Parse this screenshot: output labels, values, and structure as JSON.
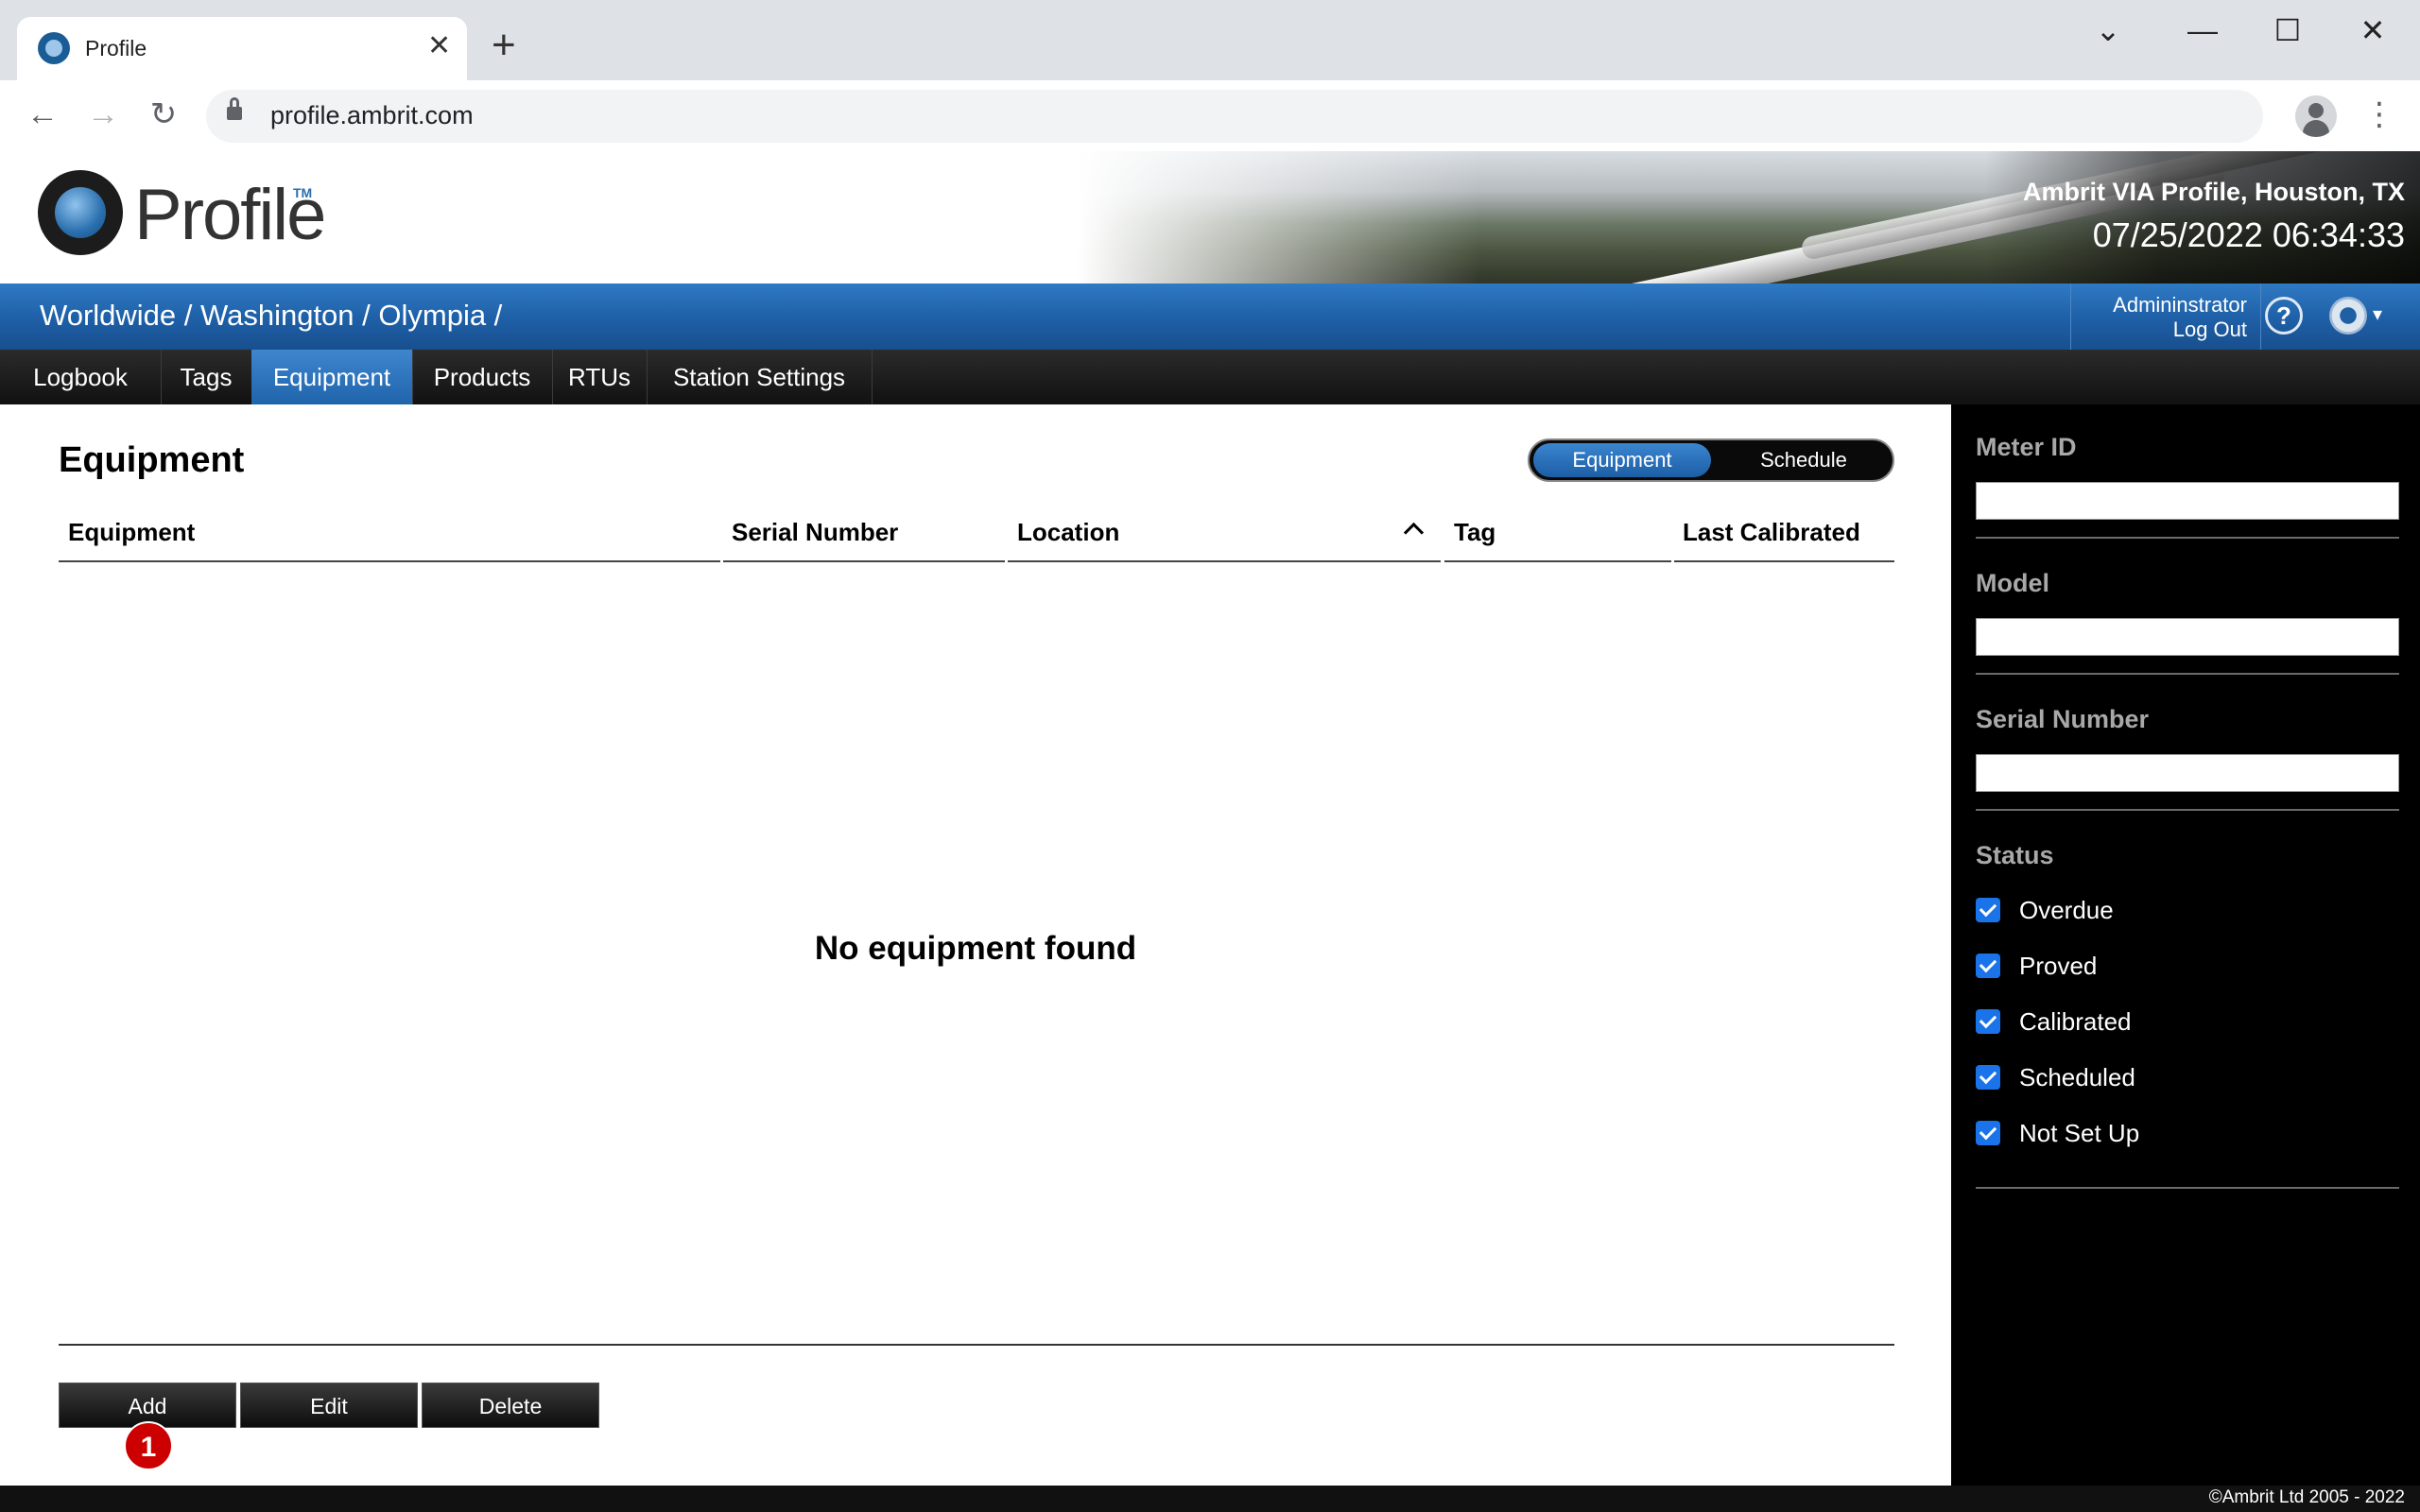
{
  "browser": {
    "tab_title": "Profile",
    "url": "profile.ambrit.com",
    "new_tab_glyph": "+",
    "close_tab_glyph": "✕",
    "back_glyph": "←",
    "forward_glyph": "→",
    "reload_glyph": "↻",
    "menu_glyph": "⋮",
    "minimize_glyph": "—",
    "maximize_glyph": "☐",
    "window_close_glyph": "✕",
    "tab_list_glyph": "⌄"
  },
  "header": {
    "logo_text": "Profile",
    "logo_tm": "TM",
    "site_name": "Ambrit VIA Profile, Houston, TX",
    "datetime": "07/25/2022 06:34:33"
  },
  "breadcrumb": "Worldwide / Washington / Olympia /",
  "user": {
    "name": "Admininstrator",
    "logout": "Log Out",
    "help_glyph": "?",
    "gear_caret": "▾"
  },
  "nav": {
    "tabs": [
      {
        "label": "Logbook"
      },
      {
        "label": "Tags"
      },
      {
        "label": "Equipment",
        "active": true
      },
      {
        "label": "Products"
      },
      {
        "label": "RTUs"
      },
      {
        "label": "Station Settings"
      }
    ]
  },
  "main": {
    "title": "Equipment",
    "toggle": {
      "equipment": "Equipment",
      "schedule": "Schedule"
    },
    "columns": [
      "Equipment",
      "Serial Number",
      "Location",
      "Tag",
      "Last Calibrated"
    ],
    "empty_message": "No equipment found",
    "buttons": {
      "add": "Add",
      "edit": "Edit",
      "delete": "Delete"
    },
    "badge": "1"
  },
  "filters": {
    "meter_id_label": "Meter ID",
    "meter_id_value": "",
    "model_label": "Model",
    "model_value": "",
    "serial_label": "Serial Number",
    "serial_value": "",
    "status_label": "Status",
    "statuses": [
      {
        "label": "Overdue",
        "checked": true
      },
      {
        "label": "Proved",
        "checked": true
      },
      {
        "label": "Calibrated",
        "checked": true
      },
      {
        "label": "Scheduled",
        "checked": true
      },
      {
        "label": "Not Set Up",
        "checked": true
      }
    ]
  },
  "footer": {
    "copyright": "©Ambrit Ltd 2005 - 2022"
  },
  "colors": {
    "accent_blue": "#1f64ab",
    "nav_dark": "#111111",
    "badge_red": "#cc0000",
    "checkbox_blue": "#1a73e8"
  }
}
